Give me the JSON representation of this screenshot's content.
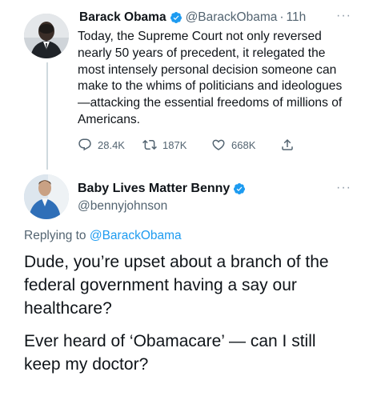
{
  "original_tweet": {
    "author_name": "Barack Obama",
    "handle": "@BarackObama",
    "separator": "·",
    "time": "11h",
    "more": "···",
    "text": "Today, the Supreme Court not only reversed nearly 50 years of precedent, it relegated the most intensely personal decision someone can make to the whims of politicians and ideologues—attacking the essential freedoms of millions of Americans.",
    "actions": {
      "replies": "28.4K",
      "retweets": "187K",
      "likes": "668K"
    }
  },
  "reply_tweet": {
    "author_name": "Baby Lives Matter Benny",
    "handle": "@bennyjohnson",
    "more": "···",
    "replying_prefix": "Replying to",
    "replying_to": "@BarackObama",
    "paragraph1": "Dude, you’re upset about a branch of the federal government having a say our healthcare?",
    "paragraph2": "Ever heard of ‘Obamacare’ — can I still keep my doctor?"
  },
  "colors": {
    "accent": "#1d9bf0",
    "text": "#0f1419",
    "muted": "#536471",
    "thread_line": "#cfd9de"
  },
  "icons": [
    "verified-badge-icon",
    "reply-icon",
    "retweet-icon",
    "like-icon",
    "share-icon"
  ]
}
